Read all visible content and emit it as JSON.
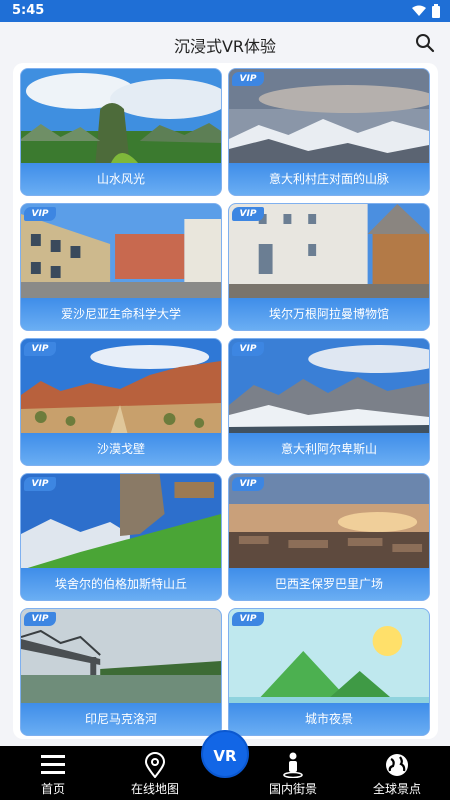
{
  "status_bar": {
    "time": "5:45"
  },
  "app_bar": {
    "title": "沉浸式VR体验",
    "search_icon": "search-icon"
  },
  "cards": [
    {
      "title": "山水风光",
      "vip": false,
      "vip_label": ""
    },
    {
      "title": "意大利村庄对面的山脉",
      "vip": true,
      "vip_label": "VIP"
    },
    {
      "title": "爱沙尼亚生命科学大学",
      "vip": true,
      "vip_label": "VIP"
    },
    {
      "title": "埃尔万根阿拉曼博物馆",
      "vip": true,
      "vip_label": "VIP"
    },
    {
      "title": "沙漠戈壁",
      "vip": true,
      "vip_label": "VIP"
    },
    {
      "title": "意大利阿尔卑斯山",
      "vip": true,
      "vip_label": "VIP"
    },
    {
      "title": "埃舍尔的伯格加斯特山丘",
      "vip": true,
      "vip_label": "VIP"
    },
    {
      "title": "巴西圣保罗巴里广场",
      "vip": true,
      "vip_label": "VIP"
    },
    {
      "title": "印尼马克洛河",
      "vip": true,
      "vip_label": "VIP"
    },
    {
      "title": "城市夜景",
      "vip": true,
      "vip_label": "VIP"
    }
  ],
  "nav": {
    "home": "首页",
    "map": "在线地图",
    "vr": "VR",
    "street": "国内街景",
    "global": "全球景点"
  },
  "colors": {
    "accent": "#1f6fd6",
    "card_caption": "#4a94eb",
    "vr_button": "#1266e6"
  }
}
